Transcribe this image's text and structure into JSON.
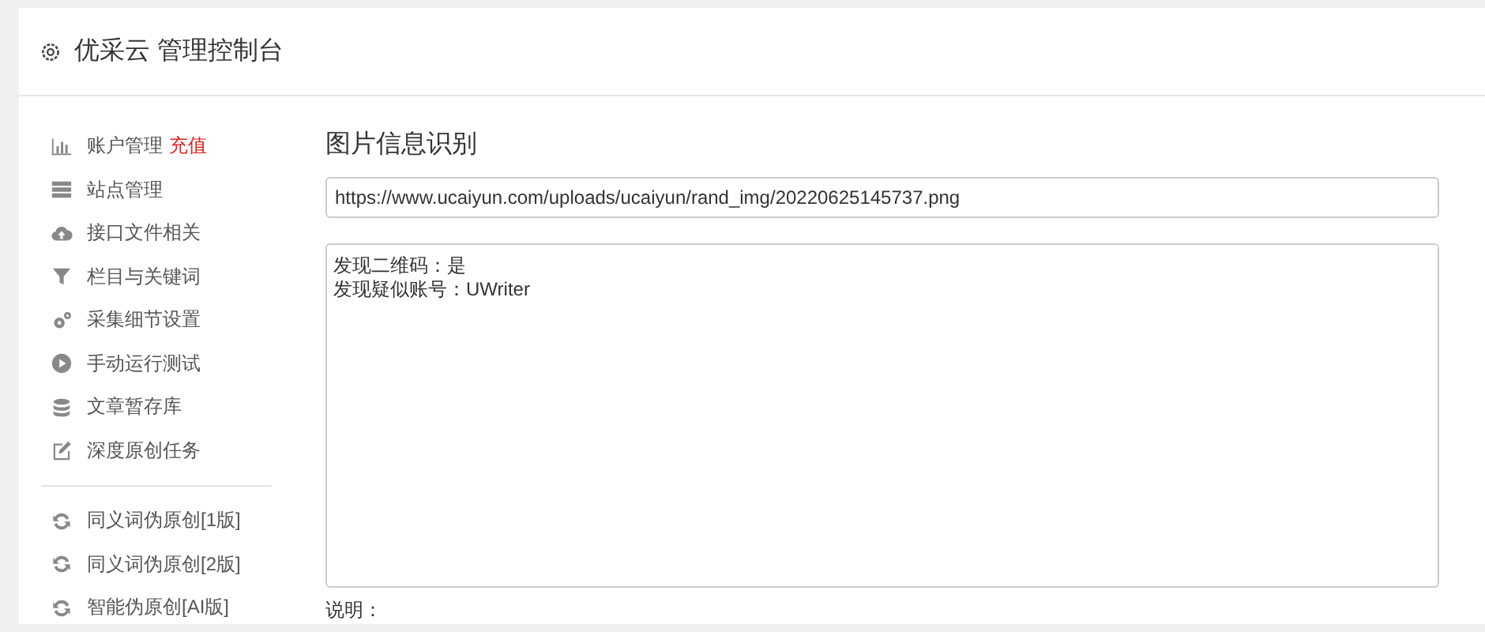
{
  "header": {
    "title": "优采云 管理控制台"
  },
  "sidebar": {
    "groups": [
      [
        {
          "label": "账户管理",
          "badge": "充值"
        },
        {
          "label": "站点管理"
        },
        {
          "label": "接口文件相关"
        },
        {
          "label": "栏目与关键词"
        },
        {
          "label": "采集细节设置"
        },
        {
          "label": "手动运行测试"
        },
        {
          "label": "文章暂存库"
        },
        {
          "label": "深度原创任务"
        }
      ],
      [
        {
          "label": "同义词伪原创[1版]"
        },
        {
          "label": "同义词伪原创[2版]"
        },
        {
          "label": "智能伪原创[AI版]"
        }
      ]
    ]
  },
  "content": {
    "title": "图片信息识别",
    "url": "https://www.ucaiyun.com/uploads/ucaiyun/rand_img/20220625145737.png",
    "result_lines": [
      "发现二维码：是",
      "发现疑似账号：UWriter"
    ],
    "note_label": "说明："
  }
}
